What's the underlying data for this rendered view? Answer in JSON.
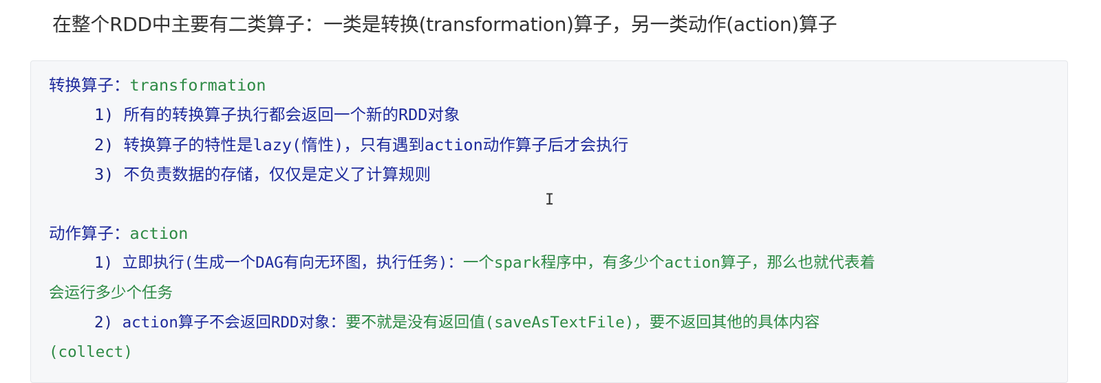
{
  "heading": "在整个RDD中主要有二类算子：一类是转换(transformation)算子，另一类动作(action)算子",
  "transformation": {
    "title_label": "转换算子：",
    "title_keyword": "transformation",
    "items": [
      {
        "num": "1)",
        "text": "所有的转换算子执行都会返回一个新的RDD对象"
      },
      {
        "num": "2)",
        "text": "转换算子的特性是lazy(惰性)，只有遇到action动作算子后才会执行"
      },
      {
        "num": "3)",
        "text": "不负责数据的存储，仅仅是定义了计算规则"
      }
    ]
  },
  "action": {
    "title_label": "动作算子：",
    "title_keyword": "action",
    "items": [
      {
        "num": "1)",
        "text_blue": "立即执行(生成一个DAG有向无环图，执行任务)：",
        "text_green": "一个spark程序中，有多少个action算子，那么也就代表着",
        "continuation": "会运行多少个任务"
      },
      {
        "num": "2)",
        "text_blue": "action算子不会返回RDD对象：",
        "text_green": "要不就是没有返回值(saveAsTextFile)，要不返回其他的具体内容",
        "continuation": "(collect)"
      }
    ]
  },
  "cursor_glyph": "I"
}
